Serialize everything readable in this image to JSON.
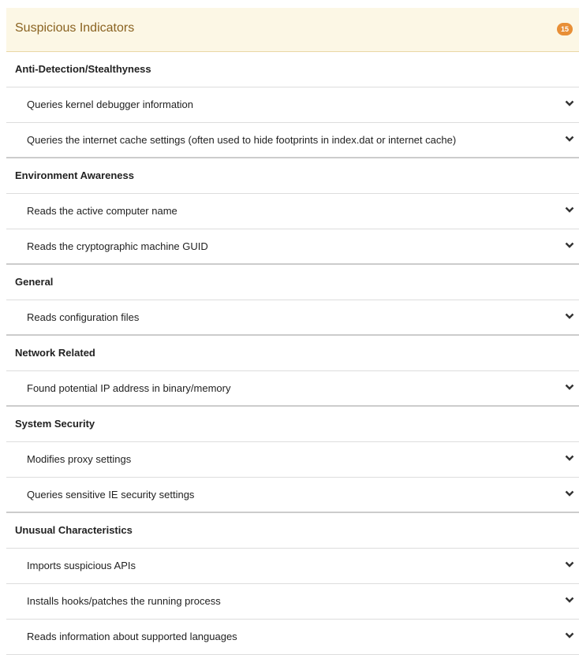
{
  "panel": {
    "title": "Suspicious Indicators",
    "count": "15",
    "accent_color": "#e88f36",
    "header_background": "#fcf7e5"
  },
  "groups": [
    {
      "category": "Anti-Detection/Stealthyness",
      "items": [
        "Queries kernel debugger information",
        "Queries the internet cache settings (often used to hide footprints in index.dat or internet cache)"
      ]
    },
    {
      "category": "Environment Awareness",
      "items": [
        "Reads the active computer name",
        "Reads the cryptographic machine GUID"
      ]
    },
    {
      "category": "General",
      "items": [
        "Reads configuration files"
      ]
    },
    {
      "category": "Network Related",
      "items": [
        "Found potential IP address in binary/memory"
      ]
    },
    {
      "category": "System Security",
      "items": [
        "Modifies proxy settings",
        "Queries sensitive IE security settings"
      ]
    },
    {
      "category": "Unusual Characteristics",
      "items": [
        "Imports suspicious APIs",
        "Installs hooks/patches the running process",
        "Reads information about supported languages"
      ]
    }
  ],
  "icons": {
    "expand": "chevron-down-icon"
  }
}
